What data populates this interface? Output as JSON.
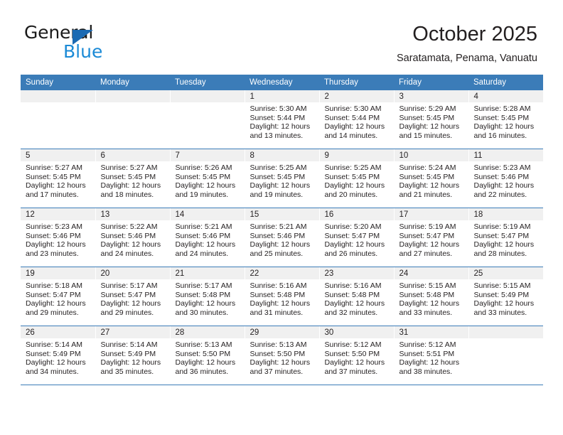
{
  "brand": {
    "name_part1": "General",
    "name_part2": "Blue",
    "triangle_color": "#1b6ab3",
    "blue_color": "#1b8ad6"
  },
  "header": {
    "month_title": "October 2025",
    "location": "Saratamata, Penama, Vanuatu"
  },
  "theme": {
    "header_bg": "#3b7cb8",
    "day_band_bg": "#f0f0f0",
    "row_divider": "#3b7cb8",
    "text": "#231f20"
  },
  "weekdays": [
    "Sunday",
    "Monday",
    "Tuesday",
    "Wednesday",
    "Thursday",
    "Friday",
    "Saturday"
  ],
  "labels": {
    "sunrise_prefix": "Sunrise:",
    "sunset_prefix": "Sunset:",
    "daylight_prefix": "Daylight:"
  },
  "weeks": [
    [
      {
        "day": "",
        "empty": true
      },
      {
        "day": "",
        "empty": true
      },
      {
        "day": "",
        "empty": true
      },
      {
        "day": "1",
        "sunrise": "Sunrise: 5:30 AM",
        "sunset": "Sunset: 5:44 PM",
        "daylight1": "Daylight: 12 hours",
        "daylight2": "and 13 minutes."
      },
      {
        "day": "2",
        "sunrise": "Sunrise: 5:30 AM",
        "sunset": "Sunset: 5:44 PM",
        "daylight1": "Daylight: 12 hours",
        "daylight2": "and 14 minutes."
      },
      {
        "day": "3",
        "sunrise": "Sunrise: 5:29 AM",
        "sunset": "Sunset: 5:45 PM",
        "daylight1": "Daylight: 12 hours",
        "daylight2": "and 15 minutes."
      },
      {
        "day": "4",
        "sunrise": "Sunrise: 5:28 AM",
        "sunset": "Sunset: 5:45 PM",
        "daylight1": "Daylight: 12 hours",
        "daylight2": "and 16 minutes."
      }
    ],
    [
      {
        "day": "5",
        "sunrise": "Sunrise: 5:27 AM",
        "sunset": "Sunset: 5:45 PM",
        "daylight1": "Daylight: 12 hours",
        "daylight2": "and 17 minutes."
      },
      {
        "day": "6",
        "sunrise": "Sunrise: 5:27 AM",
        "sunset": "Sunset: 5:45 PM",
        "daylight1": "Daylight: 12 hours",
        "daylight2": "and 18 minutes."
      },
      {
        "day": "7",
        "sunrise": "Sunrise: 5:26 AM",
        "sunset": "Sunset: 5:45 PM",
        "daylight1": "Daylight: 12 hours",
        "daylight2": "and 19 minutes."
      },
      {
        "day": "8",
        "sunrise": "Sunrise: 5:25 AM",
        "sunset": "Sunset: 5:45 PM",
        "daylight1": "Daylight: 12 hours",
        "daylight2": "and 19 minutes."
      },
      {
        "day": "9",
        "sunrise": "Sunrise: 5:25 AM",
        "sunset": "Sunset: 5:45 PM",
        "daylight1": "Daylight: 12 hours",
        "daylight2": "and 20 minutes."
      },
      {
        "day": "10",
        "sunrise": "Sunrise: 5:24 AM",
        "sunset": "Sunset: 5:45 PM",
        "daylight1": "Daylight: 12 hours",
        "daylight2": "and 21 minutes."
      },
      {
        "day": "11",
        "sunrise": "Sunrise: 5:23 AM",
        "sunset": "Sunset: 5:46 PM",
        "daylight1": "Daylight: 12 hours",
        "daylight2": "and 22 minutes."
      }
    ],
    [
      {
        "day": "12",
        "sunrise": "Sunrise: 5:23 AM",
        "sunset": "Sunset: 5:46 PM",
        "daylight1": "Daylight: 12 hours",
        "daylight2": "and 23 minutes."
      },
      {
        "day": "13",
        "sunrise": "Sunrise: 5:22 AM",
        "sunset": "Sunset: 5:46 PM",
        "daylight1": "Daylight: 12 hours",
        "daylight2": "and 24 minutes."
      },
      {
        "day": "14",
        "sunrise": "Sunrise: 5:21 AM",
        "sunset": "Sunset: 5:46 PM",
        "daylight1": "Daylight: 12 hours",
        "daylight2": "and 24 minutes."
      },
      {
        "day": "15",
        "sunrise": "Sunrise: 5:21 AM",
        "sunset": "Sunset: 5:46 PM",
        "daylight1": "Daylight: 12 hours",
        "daylight2": "and 25 minutes."
      },
      {
        "day": "16",
        "sunrise": "Sunrise: 5:20 AM",
        "sunset": "Sunset: 5:47 PM",
        "daylight1": "Daylight: 12 hours",
        "daylight2": "and 26 minutes."
      },
      {
        "day": "17",
        "sunrise": "Sunrise: 5:19 AM",
        "sunset": "Sunset: 5:47 PM",
        "daylight1": "Daylight: 12 hours",
        "daylight2": "and 27 minutes."
      },
      {
        "day": "18",
        "sunrise": "Sunrise: 5:19 AM",
        "sunset": "Sunset: 5:47 PM",
        "daylight1": "Daylight: 12 hours",
        "daylight2": "and 28 minutes."
      }
    ],
    [
      {
        "day": "19",
        "sunrise": "Sunrise: 5:18 AM",
        "sunset": "Sunset: 5:47 PM",
        "daylight1": "Daylight: 12 hours",
        "daylight2": "and 29 minutes."
      },
      {
        "day": "20",
        "sunrise": "Sunrise: 5:17 AM",
        "sunset": "Sunset: 5:47 PM",
        "daylight1": "Daylight: 12 hours",
        "daylight2": "and 29 minutes."
      },
      {
        "day": "21",
        "sunrise": "Sunrise: 5:17 AM",
        "sunset": "Sunset: 5:48 PM",
        "daylight1": "Daylight: 12 hours",
        "daylight2": "and 30 minutes."
      },
      {
        "day": "22",
        "sunrise": "Sunrise: 5:16 AM",
        "sunset": "Sunset: 5:48 PM",
        "daylight1": "Daylight: 12 hours",
        "daylight2": "and 31 minutes."
      },
      {
        "day": "23",
        "sunrise": "Sunrise: 5:16 AM",
        "sunset": "Sunset: 5:48 PM",
        "daylight1": "Daylight: 12 hours",
        "daylight2": "and 32 minutes."
      },
      {
        "day": "24",
        "sunrise": "Sunrise: 5:15 AM",
        "sunset": "Sunset: 5:48 PM",
        "daylight1": "Daylight: 12 hours",
        "daylight2": "and 33 minutes."
      },
      {
        "day": "25",
        "sunrise": "Sunrise: 5:15 AM",
        "sunset": "Sunset: 5:49 PM",
        "daylight1": "Daylight: 12 hours",
        "daylight2": "and 33 minutes."
      }
    ],
    [
      {
        "day": "26",
        "sunrise": "Sunrise: 5:14 AM",
        "sunset": "Sunset: 5:49 PM",
        "daylight1": "Daylight: 12 hours",
        "daylight2": "and 34 minutes."
      },
      {
        "day": "27",
        "sunrise": "Sunrise: 5:14 AM",
        "sunset": "Sunset: 5:49 PM",
        "daylight1": "Daylight: 12 hours",
        "daylight2": "and 35 minutes."
      },
      {
        "day": "28",
        "sunrise": "Sunrise: 5:13 AM",
        "sunset": "Sunset: 5:50 PM",
        "daylight1": "Daylight: 12 hours",
        "daylight2": "and 36 minutes."
      },
      {
        "day": "29",
        "sunrise": "Sunrise: 5:13 AM",
        "sunset": "Sunset: 5:50 PM",
        "daylight1": "Daylight: 12 hours",
        "daylight2": "and 37 minutes."
      },
      {
        "day": "30",
        "sunrise": "Sunrise: 5:12 AM",
        "sunset": "Sunset: 5:50 PM",
        "daylight1": "Daylight: 12 hours",
        "daylight2": "and 37 minutes."
      },
      {
        "day": "31",
        "sunrise": "Sunrise: 5:12 AM",
        "sunset": "Sunset: 5:51 PM",
        "daylight1": "Daylight: 12 hours",
        "daylight2": "and 38 minutes."
      },
      {
        "day": "",
        "empty": true
      }
    ]
  ]
}
